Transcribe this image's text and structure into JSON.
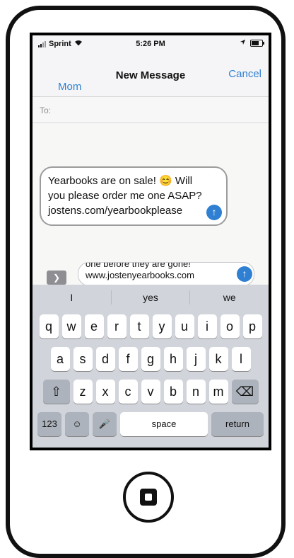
{
  "status": {
    "carrier": "Sprint",
    "time": "5:26 PM"
  },
  "nav": {
    "title": "New Message",
    "cancel": "Cancel",
    "back": "Mom"
  },
  "to": {
    "label": "To:"
  },
  "bubble_main": {
    "text": "Yearbooks are on sale! 😊 Will\nyou please order me one ASAP?\njostens.com/yearbookplease"
  },
  "compose": {
    "text": "one before they are gone!\nwww.jostenyearbooks.com"
  },
  "keyboard": {
    "suggestions": [
      "I",
      "yes",
      "we"
    ],
    "row1": [
      "q",
      "w",
      "e",
      "r",
      "t",
      "y",
      "u",
      "i",
      "o",
      "p"
    ],
    "row2": [
      "a",
      "s",
      "d",
      "f",
      "g",
      "h",
      "j",
      "k",
      "l"
    ],
    "row3": [
      "z",
      "x",
      "c",
      "v",
      "b",
      "n",
      "m"
    ],
    "numbers": "123",
    "space": "space",
    "return": "return"
  },
  "colors": {
    "accent": "#2f7fd2",
    "keyboard": "#d1d5db"
  },
  "icons": [
    "signal-icon",
    "wifi-icon",
    "location-icon",
    "battery-icon",
    "send-arrow-icon",
    "expand-chevron-icon",
    "shift-icon",
    "delete-icon",
    "emoji-icon",
    "microphone-icon",
    "home-button-icon"
  ]
}
